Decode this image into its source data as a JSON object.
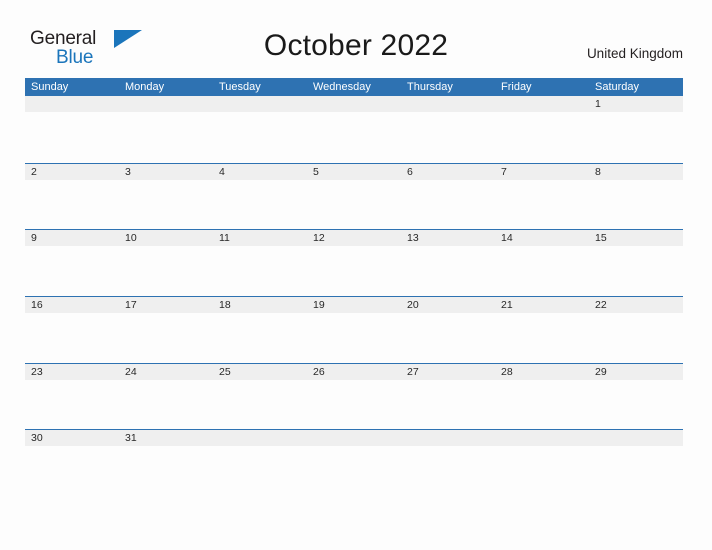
{
  "brand": {
    "word_one": "General",
    "word_two": "Blue",
    "flag_icon": "blue-triangle-flag-icon",
    "accent_color": "#1b75bb"
  },
  "header": {
    "title": "October 2022",
    "region": "United Kingdom"
  },
  "theme": {
    "header_blue": "#2e72b2",
    "row_line_blue": "#2e72b2",
    "date_strip_gray": "#efefef",
    "page_background": "#fdfdfd",
    "text_dark": "#282828"
  },
  "calendar": {
    "month": "October",
    "year": "2022",
    "day_headers": [
      "Sunday",
      "Monday",
      "Tuesday",
      "Wednesday",
      "Thursday",
      "Friday",
      "Saturday"
    ],
    "weeks": [
      [
        "",
        "",
        "",
        "",
        "",
        "",
        "1"
      ],
      [
        "2",
        "3",
        "4",
        "5",
        "6",
        "7",
        "8"
      ],
      [
        "9",
        "10",
        "11",
        "12",
        "13",
        "14",
        "15"
      ],
      [
        "16",
        "17",
        "18",
        "19",
        "20",
        "21",
        "22"
      ],
      [
        "23",
        "24",
        "25",
        "26",
        "27",
        "28",
        "29"
      ],
      [
        "30",
        "31",
        "",
        "",
        "",
        "",
        ""
      ]
    ]
  }
}
